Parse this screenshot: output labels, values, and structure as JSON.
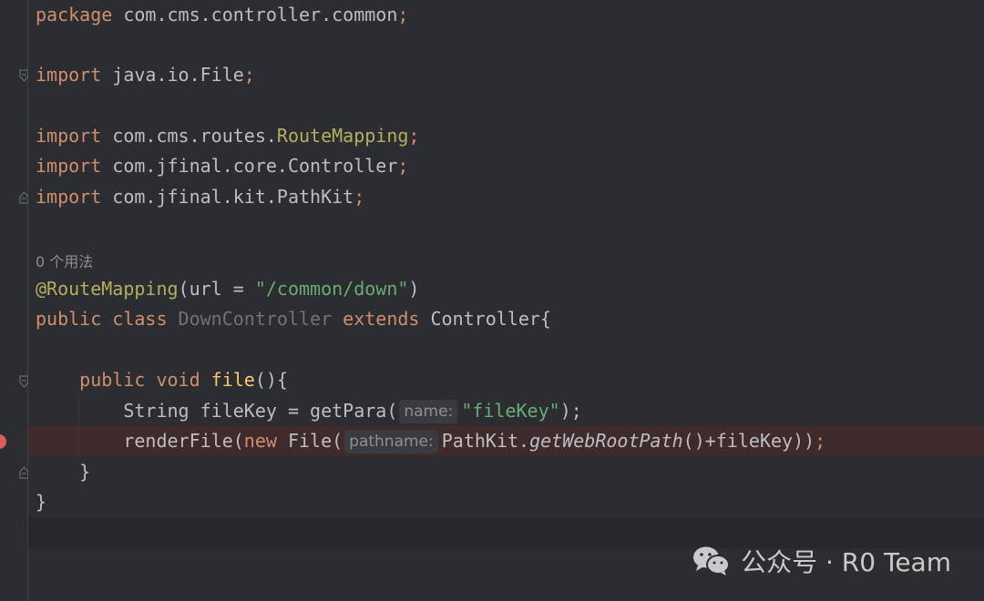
{
  "code": {
    "package_kw": "package",
    "package_name": " com.cms.controller.common",
    "semi": ";",
    "import_kw": "import",
    "import1": " java.io.File",
    "import2_pre": " com.cms.routes.",
    "import2_cls": "RouteMapping",
    "import3": " com.jfinal.core.Controller",
    "import4": " com.jfinal.kit.PathKit",
    "usages": "0 个用法",
    "annotation": "@RouteMapping",
    "ann_args_open": "(url = ",
    "ann_str": "\"/common/down\"",
    "ann_close": ")",
    "public_kw": "public",
    "class_kw": " class ",
    "class_name": "DownController",
    "extends_kw": " extends ",
    "class_tail": "Controller{",
    "void_kw": " void ",
    "method_name": "file",
    "method_tail": "(){",
    "line1_pre": "String fileKey = getPara(",
    "hint_name": "name:",
    "line1_str": "\"fileKey\"",
    "line1_tail": ");",
    "line2_pre": "renderFile(",
    "new_kw": "new",
    "line2_mid": " File(",
    "hint_pathname": "pathname:",
    "line2_pathkit": "PathKit.",
    "line2_italic": "getWebRootPath",
    "line2_tail": "()+fileKey))",
    "close_inner": "}",
    "close_outer": "}"
  },
  "watermark": {
    "text": "公众号 · R0 Team"
  },
  "colors": {
    "background": "#2b2d30",
    "keyword": "#cf8e6d",
    "annotation": "#b3ae60",
    "string": "#6aab73",
    "breakpoint": "#db5c5c"
  }
}
